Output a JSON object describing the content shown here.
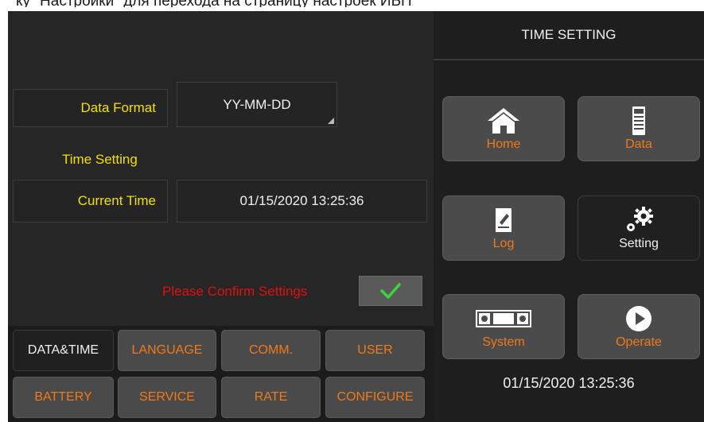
{
  "caption": "ку \"Настройки\" для перехода на страницу настроек ИБП",
  "panel": {
    "title": "TIME SETTING"
  },
  "fields": {
    "data_format_label": "Data Format",
    "data_format_value": "YY-MM-DD",
    "section_label": "Time Setting",
    "current_time_label": "Current Time",
    "current_time_value": "01/15/2020  13:25:36"
  },
  "confirm": {
    "text": "Please Confirm Settings",
    "icon": "checkmark-icon"
  },
  "tabs": [
    {
      "label": "DATA&TIME",
      "active": true
    },
    {
      "label": "LANGUAGE"
    },
    {
      "label": "COMM."
    },
    {
      "label": "USER"
    },
    {
      "label": "BATTERY"
    },
    {
      "label": "SERVICE"
    },
    {
      "label": "RATE"
    },
    {
      "label": "CONFIGURE"
    }
  ],
  "nav": [
    {
      "label": "Home",
      "icon": "home-icon"
    },
    {
      "label": "Data",
      "icon": "battery-meter-icon"
    },
    {
      "label": "Log",
      "icon": "log-icon"
    },
    {
      "label": "Setting",
      "icon": "gears-icon",
      "active": true
    },
    {
      "label": "System",
      "icon": "system-icon"
    },
    {
      "label": "Operate",
      "icon": "play-icon"
    }
  ],
  "clock": "01/15/2020  13:25:36",
  "colors": {
    "accent": "#f07a18",
    "label": "#f2e000",
    "alert": "#e01010",
    "confirm": "#3cd43c"
  }
}
